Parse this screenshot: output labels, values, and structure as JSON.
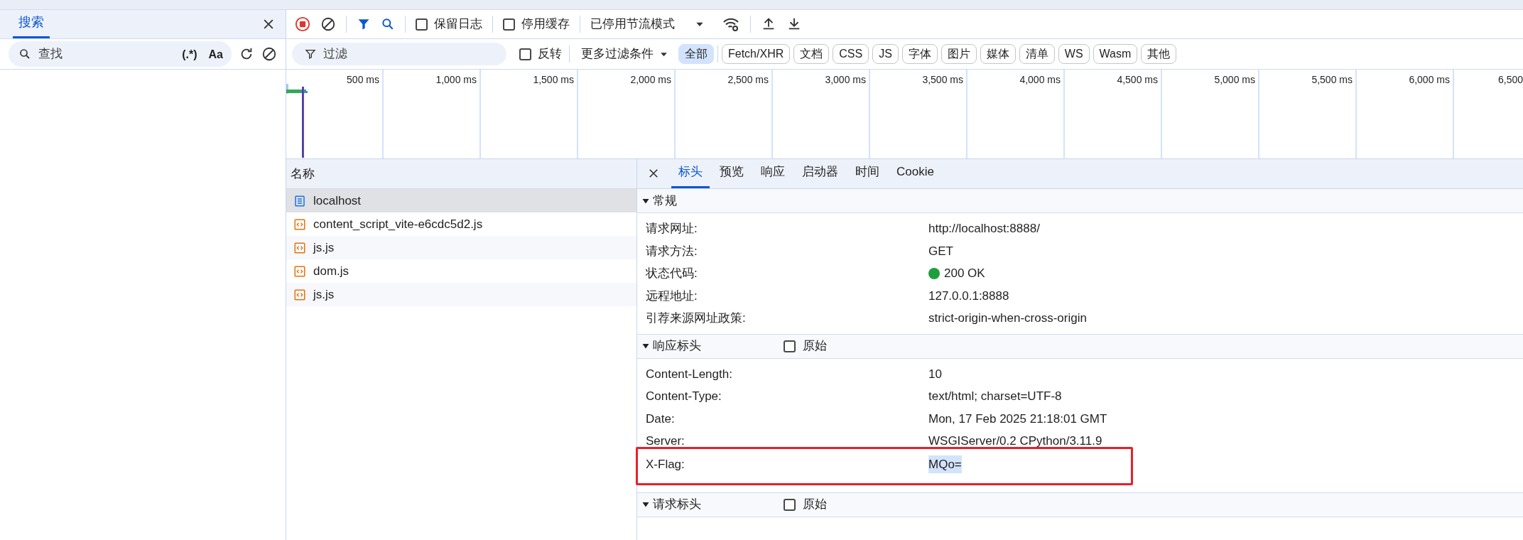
{
  "search_panel": {
    "tab": {
      "label": "搜索",
      "selected": true
    },
    "placeholder": "查找",
    "regex_label": "(.*)",
    "case_label": "Aa"
  },
  "toolbar": {
    "recording": true,
    "checkboxes": [
      {
        "label": "保留日志",
        "checked": false
      },
      {
        "label": "停用缓存",
        "checked": false
      }
    ],
    "throttle": "已停用节流模式"
  },
  "filter_bar": {
    "placeholder": "过滤",
    "invert": {
      "label": "反转",
      "checked": false
    },
    "more_filters": "更多过滤条件",
    "types": [
      {
        "label": "全部",
        "selected": true
      },
      {
        "label": "Fetch/XHR",
        "selected": false
      },
      {
        "label": "文档",
        "selected": false
      },
      {
        "label": "CSS",
        "selected": false
      },
      {
        "label": "JS",
        "selected": false
      },
      {
        "label": "字体",
        "selected": false
      },
      {
        "label": "图片",
        "selected": false
      },
      {
        "label": "媒体",
        "selected": false
      },
      {
        "label": "清单",
        "selected": false
      },
      {
        "label": "WS",
        "selected": false
      },
      {
        "label": "Wasm",
        "selected": false
      },
      {
        "label": "其他",
        "selected": false
      }
    ]
  },
  "timeline": {
    "ticks": [
      "500 ms",
      "1,000 ms",
      "1,500 ms",
      "2,000 ms",
      "2,500 ms",
      "3,000 ms",
      "3,500 ms",
      "4,000 ms",
      "4,500 ms",
      "5,000 ms",
      "5,500 ms",
      "6,000 ms",
      "6,500"
    ]
  },
  "requests": {
    "column": "名称",
    "rows": [
      {
        "name": "localhost",
        "kind": "document",
        "selected": true
      },
      {
        "name": "content_script_vite-e6cdc5d2.js",
        "kind": "script",
        "selected": false
      },
      {
        "name": "js.js",
        "kind": "script",
        "selected": false
      },
      {
        "name": "dom.js",
        "kind": "script",
        "selected": false
      },
      {
        "name": "js.js",
        "kind": "script",
        "selected": false
      }
    ]
  },
  "details": {
    "tabs": [
      {
        "label": "标头",
        "selected": true
      },
      {
        "label": "预览",
        "selected": false
      },
      {
        "label": "响应",
        "selected": false
      },
      {
        "label": "启动器",
        "selected": false
      },
      {
        "label": "时间",
        "selected": false
      },
      {
        "label": "Cookie",
        "selected": false
      }
    ],
    "sections": [
      {
        "title": "常规",
        "rows": [
          {
            "name": "请求网址:",
            "value": "http://localhost:8888/"
          },
          {
            "name": "请求方法:",
            "value": "GET"
          },
          {
            "name": "状态代码:",
            "value": "200 OK",
            "color": "#1e9e3e"
          },
          {
            "name": "远程地址:",
            "value": "127.0.0.1:8888"
          },
          {
            "name": "引荐来源网址政策:",
            "value": "strict-origin-when-cross-origin"
          }
        ]
      },
      {
        "title": "响应标头",
        "raw": {
          "label": "原始",
          "checked": false
        },
        "rows": [
          {
            "name": "Content-Length:",
            "value": "10"
          },
          {
            "name": "Content-Type:",
            "value": "text/html; charset=UTF-8"
          },
          {
            "name": "Date:",
            "value": "Mon, 17 Feb 2025 21:18:01 GMT"
          },
          {
            "name": "Server:",
            "value": "WSGIServer/0.2 CPython/3.11.9"
          },
          {
            "name": "X-Flag:",
            "value": "MQo=",
            "highlighted": true
          }
        ]
      },
      {
        "title": "请求标头",
        "raw": {
          "label": "原始",
          "checked": false
        }
      }
    ]
  }
}
